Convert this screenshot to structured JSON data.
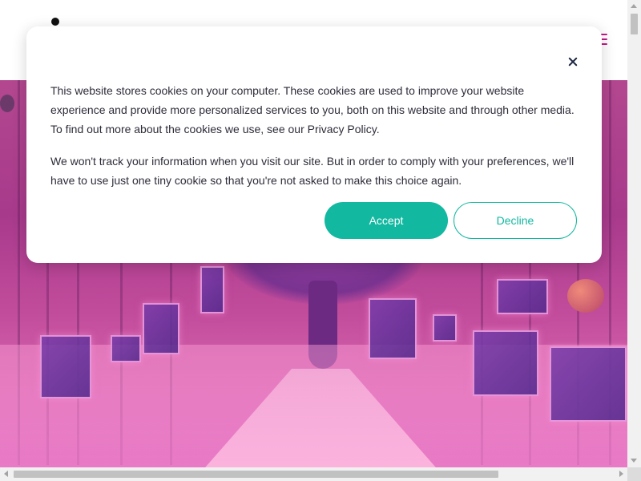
{
  "header": {
    "logo_icon": "dot-logo",
    "menu_icon": "hamburger-menu-icon",
    "accent_color": "#c2188a"
  },
  "hero": {
    "image_description_icon": "virtual-forest-gallery-image"
  },
  "cookie_banner": {
    "close_icon": "close-icon",
    "paragraph1_text": "This website stores cookies on your computer. These cookies are used to improve your website experience and provide more personalized services to you, both on this website and through other media. To find out more about the cookies we use, see our ",
    "privacy_link": "Privacy Policy",
    "paragraph1_end": ".",
    "paragraph2": "We won't track your information when you visit our site. But in order to comply with your preferences, we'll have to use just one tiny cookie so that you're not asked to make this choice again.",
    "accept_label": "Accept",
    "decline_label": "Decline",
    "button_color": "#12b8a0"
  }
}
